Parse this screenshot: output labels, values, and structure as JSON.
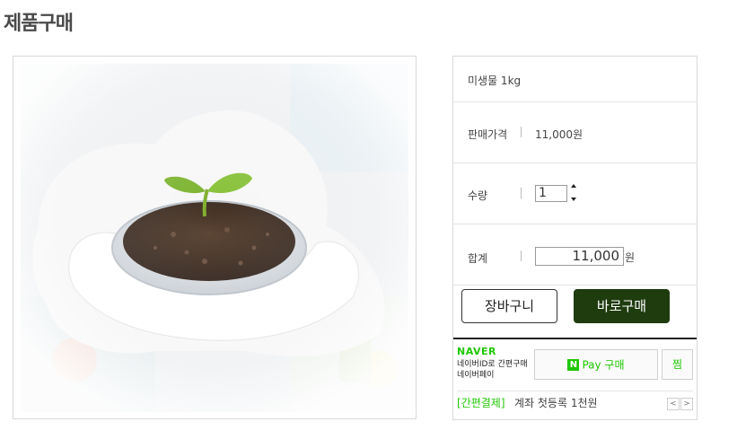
{
  "page": {
    "title": "제품구매"
  },
  "product": {
    "name": "미생물 1kg",
    "price_label": "판매가격",
    "price_value": "11,000원",
    "qty_label": "수량",
    "qty_value": "1",
    "total_label": "합계",
    "total_value": "11,000",
    "total_suffix": "원"
  },
  "buttons": {
    "cart": "장바구니",
    "buy": "바로구매"
  },
  "naver": {
    "logo": "NAVER",
    "desc_line1": "네이버ID로 간편구매",
    "desc_line2": "네이버페이",
    "pay_n": "N",
    "pay_label": "Pay 구매",
    "jjim": "찜",
    "promo_tag": "[간편결제]",
    "promo_text": "계좌 첫등록 1천원",
    "prev": "<",
    "next": ">"
  },
  "colors": {
    "naver_green": "#1ec800",
    "buy_button": "#1f3c0f",
    "title": "#4a4a4a"
  },
  "icons": [
    "spin-up-icon",
    "spin-down-icon",
    "naver-pay-n-icon",
    "arrow-left-icon",
    "arrow-right-icon"
  ]
}
